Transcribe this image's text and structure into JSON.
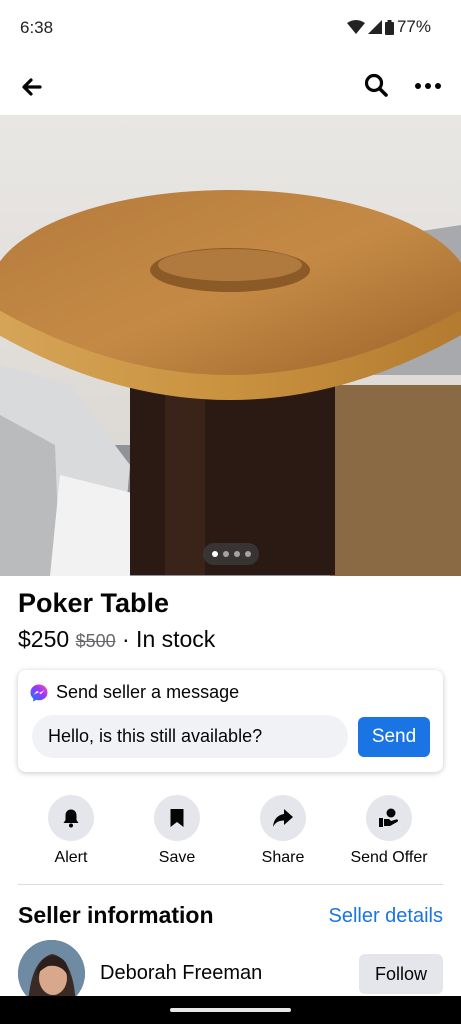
{
  "status_bar": {
    "time": "6:38",
    "battery": "77%"
  },
  "top_bar": {
    "back_icon": "arrow-left-icon",
    "search_icon": "search-icon",
    "more_icon": "more-horizontal-icon"
  },
  "photo": {
    "description_icon": "product-photo",
    "page_count": 4,
    "current_page": 1
  },
  "listing": {
    "title": "Poker Table",
    "price": "$250",
    "original_price": "$500",
    "availability": "· In stock"
  },
  "message": {
    "heading": "Send seller a message",
    "input_value": "Hello, is this still available?",
    "send_label": "Send",
    "icon": "messenger-icon"
  },
  "actions": [
    {
      "label": "Alert",
      "icon": "bell-icon"
    },
    {
      "label": "Save",
      "icon": "bookmark-icon"
    },
    {
      "label": "Share",
      "icon": "share-icon"
    },
    {
      "label": "Send Offer",
      "icon": "offer-icon"
    }
  ],
  "seller": {
    "heading": "Seller information",
    "details_link": "Seller details",
    "name": "Deborah Freeman",
    "follow_label": "Follow"
  },
  "colors": {
    "accent": "#1b74e4",
    "chip_bg": "#e4e6eb",
    "input_bg": "#f0f2f5"
  }
}
